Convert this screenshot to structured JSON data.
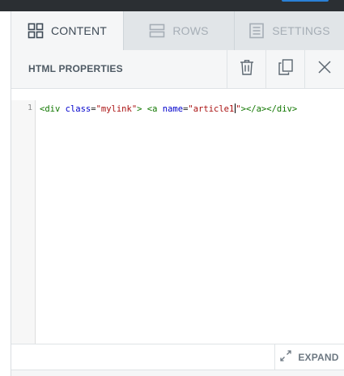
{
  "tabs": [
    {
      "label": "CONTENT",
      "icon": "grid-icon",
      "active": true
    },
    {
      "label": "ROWS",
      "icon": "rows-icon",
      "active": false
    },
    {
      "label": "SETTINGS",
      "icon": "settings-icon",
      "active": false
    }
  ],
  "properties": {
    "title": "HTML PROPERTIES",
    "actions": [
      "trash-icon",
      "duplicate-icon",
      "close-icon"
    ]
  },
  "editor": {
    "line_number": "1",
    "code": "<div class=\"mylink\"> <a name=\"article1\"></a></div>",
    "tokens": {
      "t1": "<div",
      "t2": " ",
      "t3": "class",
      "t4": "=",
      "t5": "\"mylink\"",
      "t6": ">",
      "t7": " ",
      "t8": "<a",
      "t9": " ",
      "t10": "name",
      "t11": "=",
      "t12": "\"article1",
      "t13": "\"",
      "t14": "></a></div>"
    }
  },
  "footer": {
    "expand_label": "EXPAND"
  },
  "colors": {
    "topbar": "#2b2f33",
    "accent": "#2a80d6",
    "tab_bar": "#e1e5e8",
    "active_tab": "#f5f6f7",
    "code_tag": "#117700",
    "code_attr": "#0000cc",
    "code_string": "#aa1111"
  }
}
